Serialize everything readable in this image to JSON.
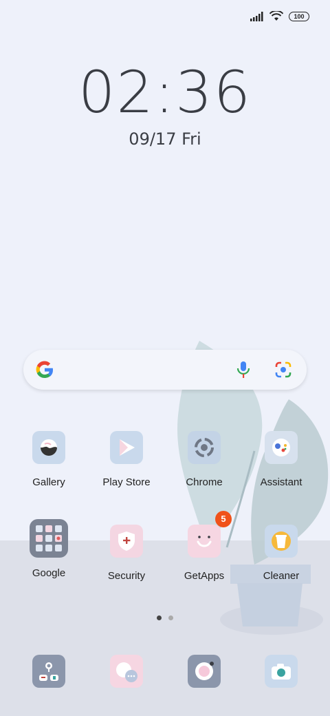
{
  "status": {
    "battery": "100"
  },
  "clock": {
    "time": "02:36",
    "date": "09/17",
    "day": "Fri"
  },
  "home_rows": [
    [
      {
        "label": "Gallery",
        "icon": "gallery-icon"
      },
      {
        "label": "Play Store",
        "icon": "play-store-icon"
      },
      {
        "label": "Chrome",
        "icon": "chrome-icon"
      },
      {
        "label": "Assistant",
        "icon": "assistant-icon"
      }
    ],
    [
      {
        "label": "Google",
        "icon": "google-folder-icon"
      },
      {
        "label": "Security",
        "icon": "security-icon"
      },
      {
        "label": "GetApps",
        "icon": "getapps-icon",
        "badge": "5"
      },
      {
        "label": "Cleaner",
        "icon": "cleaner-icon"
      }
    ]
  ],
  "dock": [
    {
      "icon": "phone-contacts-icon"
    },
    {
      "icon": "messages-icon"
    },
    {
      "icon": "camera-lens-icon"
    },
    {
      "icon": "camera-icon"
    }
  ],
  "colors": {
    "badge": "#f0521a",
    "floor": "#dde0e9",
    "background": "#eef1fa"
  }
}
